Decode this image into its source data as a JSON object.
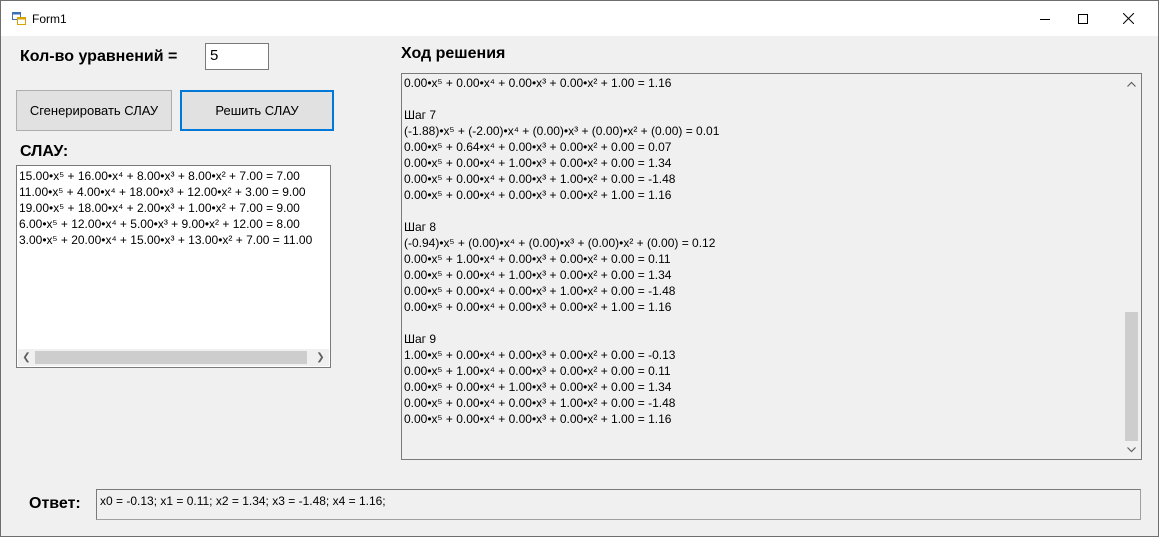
{
  "window": {
    "title": "Form1"
  },
  "equation_count": {
    "label": "Кол-во уравнений =",
    "value": "5"
  },
  "buttons": {
    "generate": "Сгенерировать СЛАУ",
    "solve": "Решить СЛАУ"
  },
  "slau": {
    "label": "СЛАУ:",
    "lines": [
      "15.00•x⁵ + 16.00•x⁴ + 8.00•x³ + 8.00•x² + 7.00 = 7.00",
      "11.00•x⁵ + 4.00•x⁴ + 18.00•x³ + 12.00•x² + 3.00 = 9.00",
      "19.00•x⁵ + 18.00•x⁴ + 2.00•x³ + 1.00•x² + 7.00 = 9.00",
      "6.00•x⁵ + 12.00•x⁴ + 5.00•x³ + 9.00•x² + 12.00 = 8.00",
      "3.00•x⁵ + 20.00•x⁴ + 15.00•x³ + 13.00•x² + 7.00 = 11.00"
    ]
  },
  "solution": {
    "label": "Ход решения",
    "lines": [
      "0.00•x⁵ + 0.00•x⁴ + 0.00•x³ + 0.00•x² + 1.00 = 1.16",
      "",
      "Шаг 7",
      "(-1.88)•x⁵ + (-2.00)•x⁴ + (0.00)•x³ + (0.00)•x² + (0.00) = 0.01",
      "0.00•x⁵ + 0.64•x⁴ + 0.00•x³ + 0.00•x² + 0.00 = 0.07",
      "0.00•x⁵ + 0.00•x⁴ + 1.00•x³ + 0.00•x² + 0.00 = 1.34",
      "0.00•x⁵ + 0.00•x⁴ + 0.00•x³ + 1.00•x² + 0.00 = -1.48",
      "0.00•x⁵ + 0.00•x⁴ + 0.00•x³ + 0.00•x² + 1.00 = 1.16",
      "",
      "Шаг 8",
      "(-0.94)•x⁵ + (0.00)•x⁴ + (0.00)•x³ + (0.00)•x² + (0.00) = 0.12",
      "0.00•x⁵ + 1.00•x⁴ + 0.00•x³ + 0.00•x² + 0.00 = 0.11",
      "0.00•x⁵ + 0.00•x⁴ + 1.00•x³ + 0.00•x² + 0.00 = 1.34",
      "0.00•x⁵ + 0.00•x⁴ + 0.00•x³ + 1.00•x² + 0.00 = -1.48",
      "0.00•x⁵ + 0.00•x⁴ + 0.00•x³ + 0.00•x² + 1.00 = 1.16",
      "",
      "Шаг 9",
      "1.00•x⁵ + 0.00•x⁴ + 0.00•x³ + 0.00•x² + 0.00 = -0.13",
      "0.00•x⁵ + 1.00•x⁴ + 0.00•x³ + 0.00•x² + 0.00 = 0.11",
      "0.00•x⁵ + 0.00•x⁴ + 1.00•x³ + 0.00•x² + 0.00 = 1.34",
      "0.00•x⁵ + 0.00•x⁴ + 0.00•x³ + 1.00•x² + 0.00 = -1.48",
      "0.00•x⁵ + 0.00•x⁴ + 0.00•x³ + 0.00•x² + 1.00 = 1.16"
    ]
  },
  "answer": {
    "label": "Ответ:",
    "value": "x0 = -0.13; x1 = 0.11; x2 = 1.34; x3 = -1.48; x4 = 1.16;"
  },
  "icons": {
    "app": "form-app-icon",
    "minimize": "minimize-icon",
    "maximize": "maximize-icon",
    "close": "close-icon"
  },
  "colors": {
    "focus_border": "#0078d7",
    "window_bg": "#f0f0f0"
  }
}
